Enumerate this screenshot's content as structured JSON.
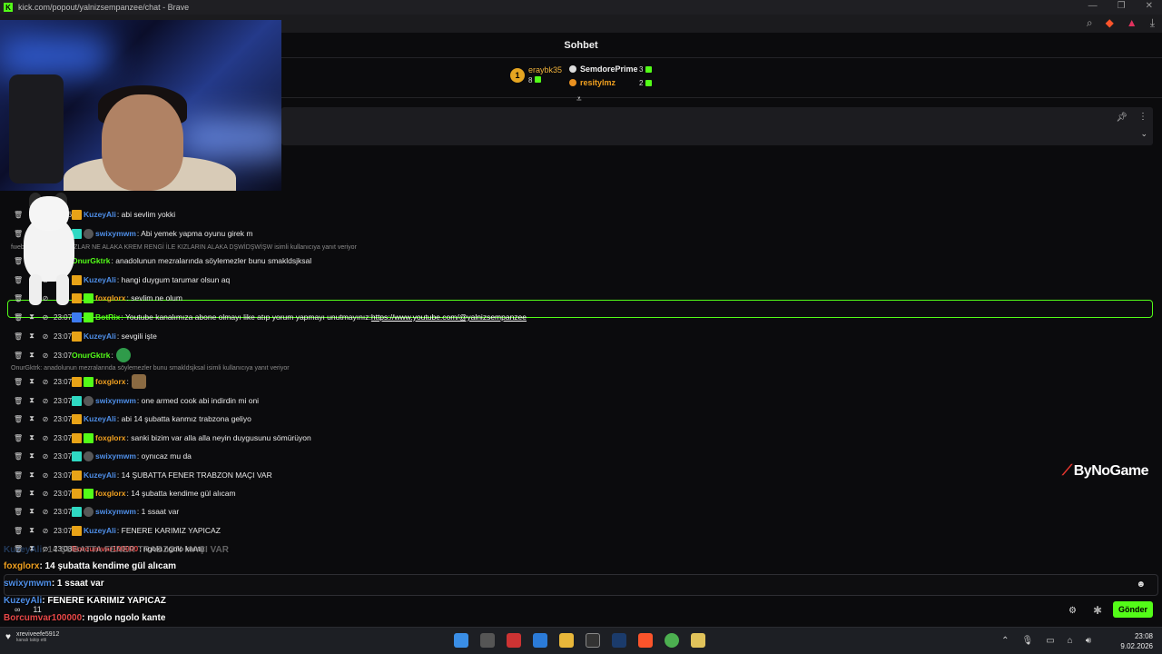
{
  "window": {
    "title": "kick.com/popout/yalnizsempanzee/chat - Brave"
  },
  "chat": {
    "header": "Sohbet",
    "leaderboard": {
      "first": {
        "rank": "1",
        "name": "eraybk35",
        "count": "8"
      },
      "others": [
        {
          "name": "SemdorePrime",
          "count": "3"
        },
        {
          "name": "resitylmz",
          "count": "2"
        }
      ]
    },
    "messages": [
      {
        "time": "23:06",
        "user": "KuzeyAli",
        "color": "#4f8fe8",
        "text": ": abi sevlim yokki"
      },
      {
        "time": "23:07",
        "user": "swixymwm",
        "color": "#4f8fe8",
        "text": ": Abi yemek yapma oyunu girek m"
      },
      {
        "reply": "fwebzer: sdiesdlsşş KIZLAR NE ALAKA KREM RENGİ İLE KIZLARIN ALAKA DŞWİDŞWİŞW isimli kullanıcıya yanıt veriyor"
      },
      {
        "time": "",
        "user": "OnurGktrk",
        "color": "#53fc18",
        "text": ": anadolunun mezralarında söylemezler bunu smakldsjksal"
      },
      {
        "time": "",
        "user": "KuzeyAli",
        "color": "#4f8fe8",
        "text": ": hangi duygum tarumar olsun aq"
      },
      {
        "time": "",
        "user": "foxglorx",
        "color": "#f0a020",
        "text": ": sevlim ne olum"
      },
      {
        "time": "23:07",
        "user": "BotRix",
        "color": "#53fc18",
        "text": ": Youtube kanalımıza abone olmayı like atıp yorum yapmayı unutmayınız: ",
        "link": "https://www.youtube.com/@yalnizsempanzee"
      },
      {
        "time": "23:07",
        "user": "KuzeyAli",
        "color": "#4f8fe8",
        "text": ": sevgili işte"
      },
      {
        "time": "23:07",
        "user": "OnurGktrk",
        "color": "#53fc18",
        "text": ":"
      },
      {
        "reply": "OnurGktrk: anadolunun mezralarında söylemezler bunu smakldsjksal isimli kullanıcıya yanıt veriyor"
      },
      {
        "time": "23:07",
        "user": "foxglorx",
        "color": "#f0a020",
        "text": ":"
      },
      {
        "time": "23:07",
        "user": "swixymwm",
        "color": "#4f8fe8",
        "text": ": one armed cook abi indirdin mi oni"
      },
      {
        "time": "23:07",
        "user": "KuzeyAli",
        "color": "#4f8fe8",
        "text": ": abi 14 şubatta kanmız trabzona geliyo"
      },
      {
        "time": "23:07",
        "user": "foxglorx",
        "color": "#f0a020",
        "text": ": sanki bizim var alla alla neyin duygusunu sömürüyon"
      },
      {
        "time": "23:07",
        "user": "swixymwm",
        "color": "#4f8fe8",
        "text": ": oynıcaz mu da"
      },
      {
        "time": "23:07",
        "user": "KuzeyAli",
        "color": "#4f8fe8",
        "text": ": 14 ŞUBATTA FENER TRABZON MAÇI VAR"
      },
      {
        "time": "23:07",
        "user": "foxglorx",
        "color": "#f0a020",
        "text": ": 14 şubatta kendime gül alıcam"
      },
      {
        "time": "23:07",
        "user": "swixymwm",
        "color": "#4f8fe8",
        "text": ": 1 ssaat var"
      },
      {
        "time": "23:07",
        "user": "KuzeyAli",
        "color": "#4f8fe8",
        "text": ": FENERE KARIMIZ YAPICAZ"
      },
      {
        "time": "23:08",
        "user": "Borcumvar100000",
        "color": "#e84848",
        "text": ": ngolo ngolo kante"
      }
    ],
    "send_label": "Gönder",
    "viewer_count": "11"
  },
  "overlay": {
    "lines": [
      {
        "user": "KuzeyAli",
        "text": ": 14 ŞUBATTA FENER TRABZON MAÇI VAR"
      },
      {
        "user": "foxglorx",
        "text": ": 14 şubatta kendime gül alıcam"
      },
      {
        "user": "swixymwm",
        "text": ": 1 ssaat var"
      },
      {
        "user": "KuzeyAli",
        "text": ": FENERE KARIMIZ YAPICAZ"
      },
      {
        "user": "Borcumvar100000",
        "text": ": ngolo ngolo kante"
      }
    ]
  },
  "watermark": "ByNoGame",
  "taskbar": {
    "follower_name": "xreviveefe5912",
    "follower_sub": "kanalı takip etti",
    "time": "23:08",
    "date": "9.02.2026"
  },
  "colors": {
    "accent": "#53fc18",
    "background": "#0b0b0d",
    "kuzey": "#4f8fe8",
    "fox": "#f0a020",
    "borcum": "#e84848"
  }
}
